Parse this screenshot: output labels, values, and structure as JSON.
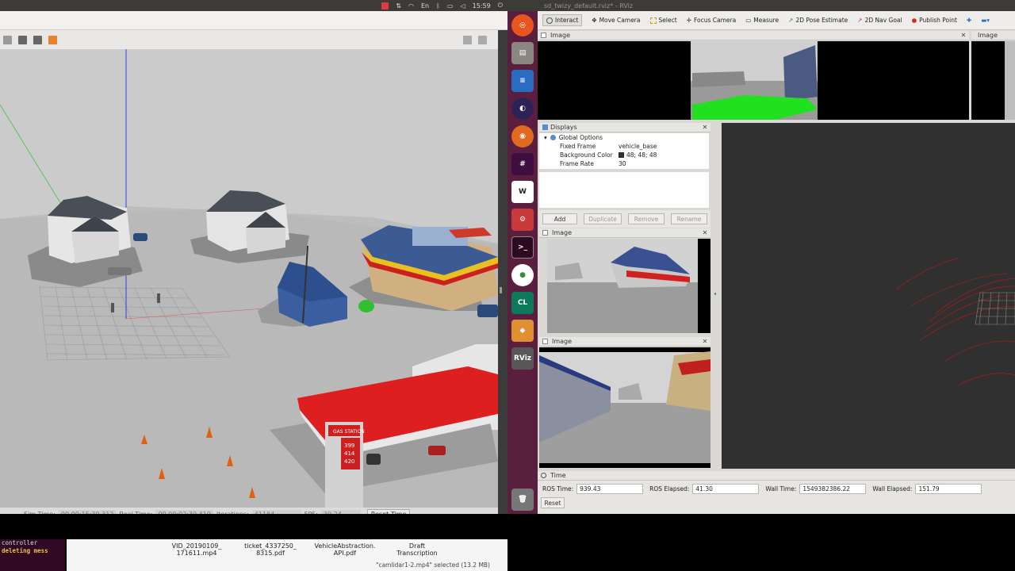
{
  "system": {
    "clock": "15:59",
    "lang": "En",
    "rviz_window_title": "sd_twizy_default.rviz* - RViz"
  },
  "gazebo": {
    "status": {
      "sim_time_label": "Sim Time:",
      "sim_time": "00 00:15:39.312",
      "real_time_label": "Real Time:",
      "real_time": "00 00:02:30.419",
      "iterations_label": "Iterations:",
      "iterations": "41184",
      "fps_label": "FPS:",
      "fps": "39.24",
      "reset_label": "Reset Time"
    },
    "scene": {
      "sign_text": "GAS STATION",
      "price1": "399",
      "price2": "414",
      "price3": "420"
    }
  },
  "rviz": {
    "toolbar": {
      "interact": "Interact",
      "move_camera": "Move Camera",
      "select": "Select",
      "focus_camera": "Focus Camera",
      "measure": "Measure",
      "pose_estimate": "2D Pose Estimate",
      "nav_goal": "2D Nav Goal",
      "publish_point": "Publish Point"
    },
    "image_top_title": "Image",
    "image_top_right_title": "Image",
    "displays": {
      "title": "Displays",
      "global_options": "Global Options",
      "rows": [
        {
          "key": "Fixed Frame",
          "value": "vehicle_base"
        },
        {
          "key": "Background Color",
          "value": "48; 48; 48"
        },
        {
          "key": "Frame Rate",
          "value": "30"
        }
      ],
      "buttons": {
        "add": "Add",
        "duplicate": "Duplicate",
        "remove": "Remove",
        "rename": "Rename"
      }
    },
    "image_mid_title": "Image",
    "image_bottom_title": "Image",
    "time": {
      "title": "Time",
      "ros_time_label": "ROS Time:",
      "ros_time": "939.43",
      "ros_elapsed_label": "ROS Elapsed:",
      "ros_elapsed": "41.30",
      "wall_time_label": "Wall Time:",
      "wall_time": "1549382386.22",
      "wall_elapsed_label": "Wall Elapsed:",
      "wall_elapsed": "151.79",
      "reset": "Reset"
    }
  },
  "launcher_apps": [
    "Ubuntu",
    "Files",
    "Writer",
    "Eclipse",
    "Firefox",
    "Slack",
    "Autoware",
    "Settings",
    "Terminal",
    "Chrome",
    "CLion",
    "Gazebo",
    "RViz",
    "Trash"
  ],
  "terminal": {
    "line1": "controller",
    "line2": "deleting mess"
  },
  "desktop": {
    "files": [
      {
        "line1": "VID_20190109_",
        "line2": "171611.mp4"
      },
      {
        "line1": "ticket_4337250_",
        "line2": "8315.pdf"
      },
      {
        "line1": "VehicleAbstraction.",
        "line2": "API.pdf"
      },
      {
        "line1": "Draft",
        "line2": "Transcription"
      }
    ],
    "selection_status": "\"camlidar1-2.mp4\" selected (13.2 MB)"
  }
}
